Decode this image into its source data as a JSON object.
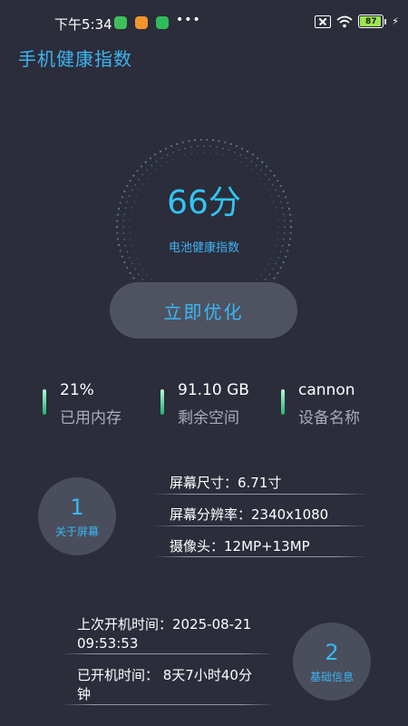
{
  "status_bar": {
    "time": "下午5:34",
    "battery": "87",
    "colors": {
      "app1": "#3fbf5a",
      "app2": "#f0962e",
      "app3": "#2fba5b",
      "battery_fill": "#9ee64e"
    },
    "icons": [
      "app-icon",
      "phone-app-icon",
      "chat-app-icon",
      "more-dots-icon",
      "sim-disabled-icon",
      "wifi-icon",
      "battery-icon",
      "charging-icon"
    ]
  },
  "header": {
    "title": "手机健康指数"
  },
  "gauge": {
    "score": "66分",
    "label": "电池健康指数"
  },
  "optimize_button": {
    "label": "立即优化"
  },
  "stats": [
    {
      "value": "21%",
      "label": "已用内存"
    },
    {
      "value": "91.10 GB",
      "label": "剩余空间"
    },
    {
      "value": "cannon",
      "label": "设备名称"
    }
  ],
  "screen_section": {
    "number": "1",
    "title": "关于屏幕",
    "rows": [
      "屏幕尺寸：6.71寸",
      "屏幕分辨率：2340x1080",
      "摄像头：12MP+13MP"
    ]
  },
  "basic_section": {
    "number": "2",
    "title": "基础信息",
    "rows": [
      {
        "line1": "上次开机时间：2025-08-21",
        "line2": "09:53:53"
      },
      {
        "line1": "已开机时间：  8天7小时40分",
        "line2": "钟"
      }
    ]
  },
  "colors": {
    "background": "#2b2d3a",
    "accent": "#38b8f5",
    "card": "#4a4d5c",
    "stat_bar": "#1fb36e"
  }
}
